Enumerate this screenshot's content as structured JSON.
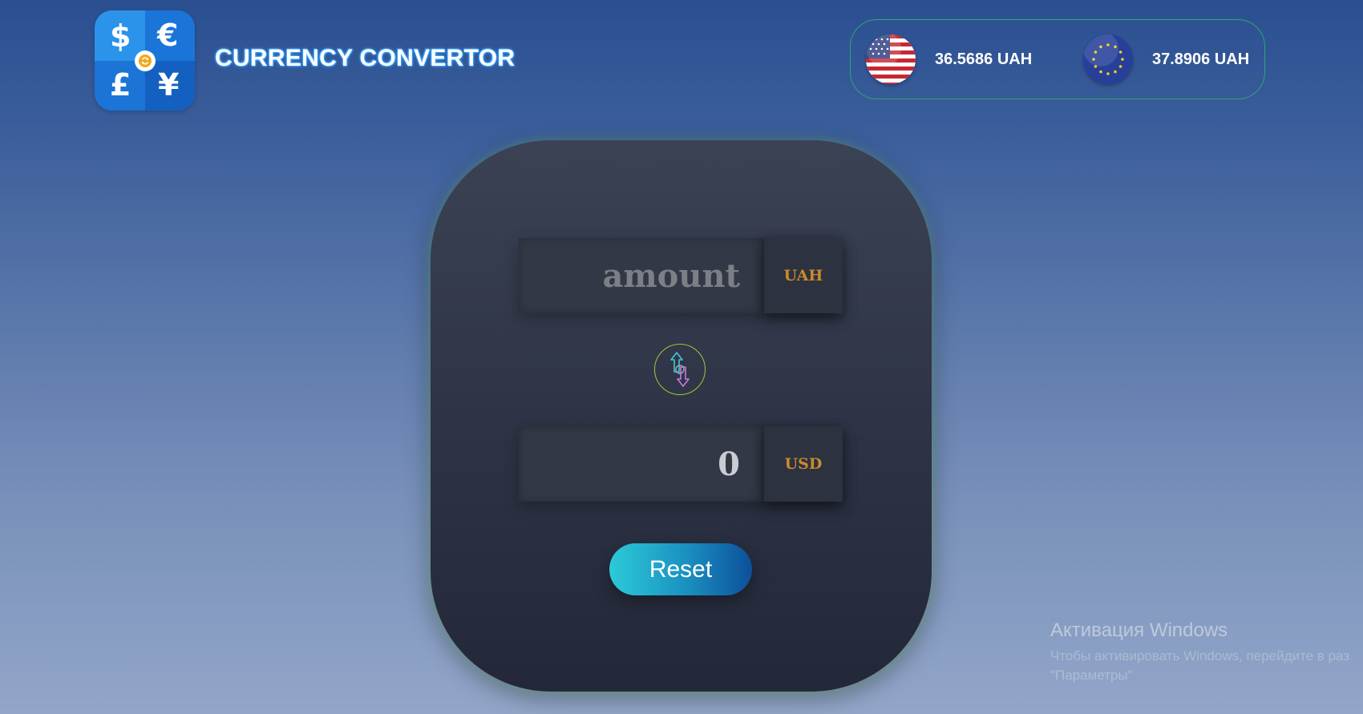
{
  "header": {
    "logo": {
      "symbols": [
        "$",
        "€",
        "£",
        "¥"
      ],
      "icon": "currency-exchange-icon"
    },
    "title": "CURRENCY CONVERTOR"
  },
  "rates": [
    {
      "flag": "us-flag-icon",
      "value": "36.5686 UAH"
    },
    {
      "flag": "eu-flag-icon",
      "value": "37.8906 UAH"
    }
  ],
  "converter": {
    "from": {
      "placeholder": "amount",
      "value": "",
      "currency": "UAH"
    },
    "swap_icon": "swap-arrows-icon",
    "to": {
      "value": "0",
      "currency": "USD"
    },
    "reset_label": "Reset"
  },
  "watermark": {
    "title": "Активация Windows",
    "line1": "Чтобы активировать Windows, перейдите в раз",
    "line2": "\"Параметры\""
  },
  "colors": {
    "accent_currency": "#c98a2b",
    "rates_border": "#2aa876",
    "swap_ring": "#a3c43a",
    "reset_gradient_start": "#2ccad8",
    "reset_gradient_end": "#0d4f9a"
  }
}
